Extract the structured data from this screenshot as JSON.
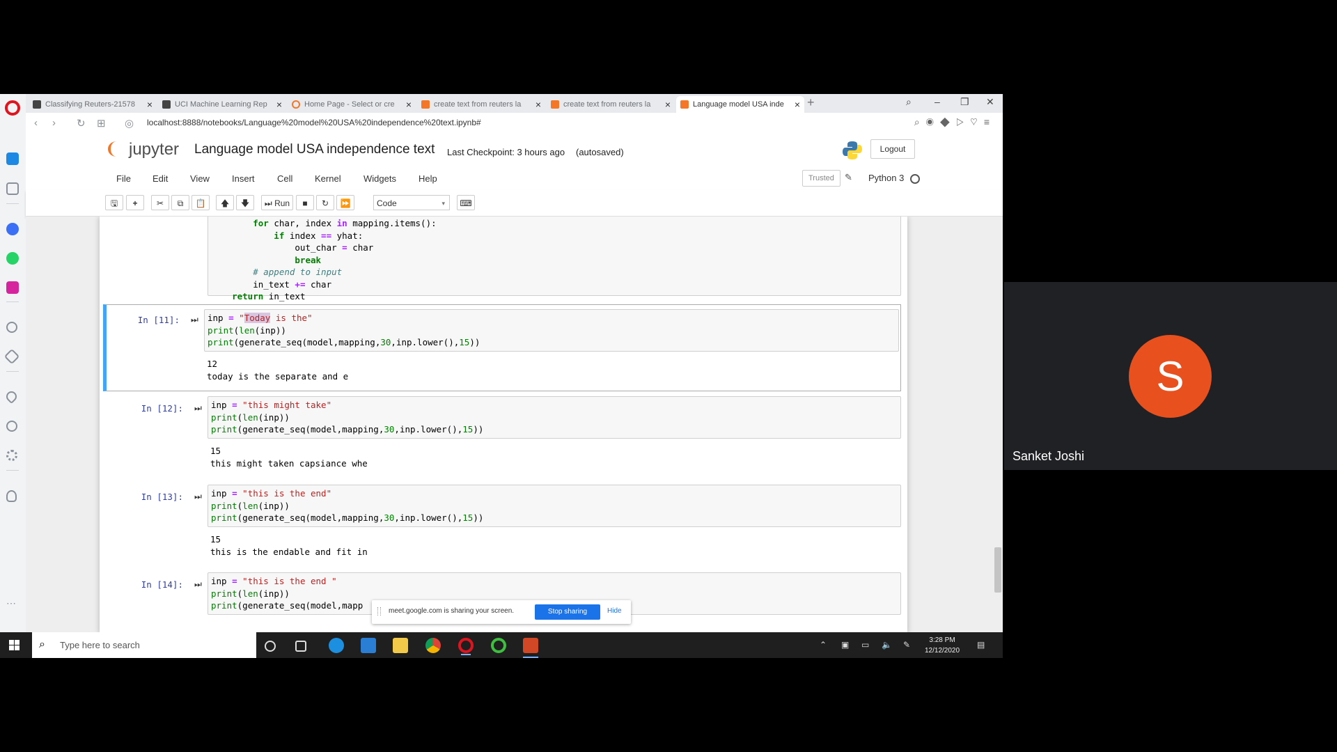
{
  "browser": {
    "tabs": [
      {
        "label": "Classifying Reuters-21578",
        "color": "#444"
      },
      {
        "label": "UCI Machine Learning Rep",
        "color": "#444"
      },
      {
        "label": "Home Page - Select or cre",
        "color": "#f37726"
      },
      {
        "label": "create text from reuters la",
        "color": "#f37726"
      },
      {
        "label": "create text from reuters la",
        "color": "#f37726"
      },
      {
        "label": "Language model USA inde",
        "color": "#f37726"
      }
    ],
    "url": "localhost:8888/notebooks/Language%20model%20USA%20independence%20text.ipynb#"
  },
  "jupyter": {
    "logo_text": "jupyter",
    "notebook_name": "Language model USA independence text",
    "checkpoint": "Last Checkpoint: 3 hours ago",
    "autosave": "(autosaved)",
    "logout": "Logout",
    "menus": [
      "File",
      "Edit",
      "View",
      "Insert",
      "Cell",
      "Kernel",
      "Widgets",
      "Help"
    ],
    "trusted": "Trusted",
    "kernel": "Python 3",
    "run_label": "Run",
    "cell_type": "Code"
  },
  "cells": [
    {
      "prompt": "In [11]:",
      "code": [
        "inp = \"Today is the\"",
        "print(len(inp))",
        "print(generate_seq(model,mapping,30,inp.lower(),15))"
      ],
      "output": [
        "12",
        "today is the separate and e"
      ]
    },
    {
      "prompt": "In [12]:",
      "code": [
        "inp = \"this might take\"",
        "print(len(inp))",
        "print(generate_seq(model,mapping,30,inp.lower(),15))"
      ],
      "output": [
        "15",
        "this might taken capsiance whe"
      ]
    },
    {
      "prompt": "In [13]:",
      "code": [
        "inp = \"this is the end\"",
        "print(len(inp))",
        "print(generate_seq(model,mapping,30,inp.lower(),15))"
      ],
      "output": [
        "15",
        "this is the endable and fit in"
      ]
    },
    {
      "prompt": "In [14]:",
      "code": [
        "inp = \"this is the end \"",
        "print(len(inp))",
        "print(generate_seq(model,mapp"
      ]
    }
  ],
  "prev_cell_code": [
    "        for char, index in mapping.items():",
    "            if index == yhat:",
    "                out_char = char",
    "                break",
    "        # append to input",
    "        in_text += char",
    "    return in_text"
  ],
  "share_notice": {
    "message": "meet.google.com is sharing your screen.",
    "stop": "Stop sharing",
    "hide": "Hide"
  },
  "taskbar": {
    "search_placeholder": "Type here to search",
    "time": "3:28 PM",
    "date": "12/12/2020"
  },
  "meet": {
    "avatar_letter": "S",
    "participant_name": "Sanket Joshi",
    "avatar_color": "#e8501e"
  }
}
